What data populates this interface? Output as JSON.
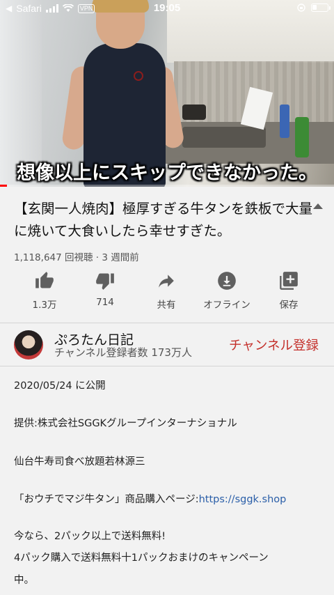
{
  "status_bar": {
    "carrier": "Safari",
    "vpn": "VPN",
    "time": "19:05"
  },
  "video": {
    "caption": "想像以上にスキップできなかった。",
    "progress": 0.02
  },
  "title": "【玄関一人焼肉】極厚すぎる牛タンを鉄板で大量に焼いて大食いしたら幸せすぎた。",
  "meta": "1,118,647 回視聴 · 3 週間前",
  "actions": [
    {
      "icon": "thumbs-up-icon",
      "label": "1.3万"
    },
    {
      "icon": "thumbs-down-icon",
      "label": "714"
    },
    {
      "icon": "share-icon",
      "label": "共有"
    },
    {
      "icon": "download-icon",
      "label": "オフライン"
    },
    {
      "icon": "save-playlist-icon",
      "label": "保存"
    }
  ],
  "channel": {
    "name": "ぷろたん日記",
    "subscribers": "チャンネル登録者数 173万人",
    "subscribe_label": "チャンネル登録"
  },
  "description": {
    "published": "2020/05/24 に公開",
    "sponsor": "提供:株式会社SGGKグループインターナショナル",
    "restaurant": "仙台牛寿司食べ放題若林源三",
    "purchase_text": "「おウチでマジ牛タン」商品購入ページ:",
    "purchase_link": "https://sggk.shop",
    "promo_line1": "今なら、2パック以上で送料無料!",
    "promo_line2": "4パック購入で送料無料十1パックおまけのキャンペーン",
    "promo_line3": "中。"
  },
  "colors": {
    "subscribe": "#c4302b",
    "link": "#2a5ea8",
    "progress": "#ff0000"
  }
}
